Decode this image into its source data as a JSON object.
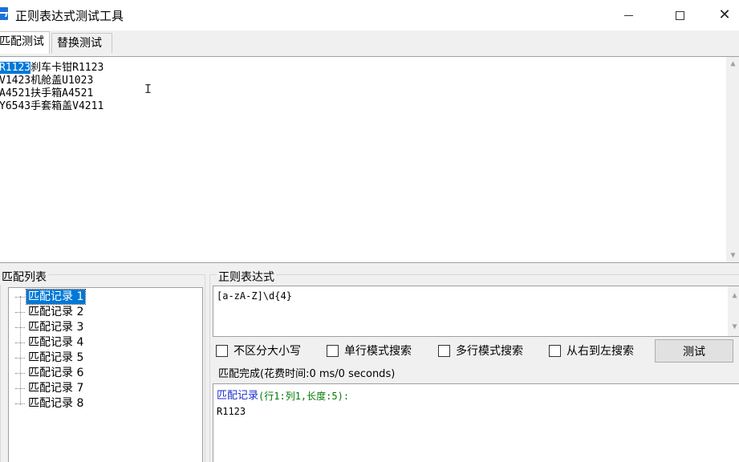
{
  "window": {
    "title": "正则表达式测试工具",
    "icon": "app-icon",
    "controls": {
      "minimize": "minimize-icon",
      "maximize": "maximize-icon",
      "close": "close-icon"
    }
  },
  "tabs": [
    {
      "label": "匹配测试",
      "active": true
    },
    {
      "label": "替换测试",
      "active": false
    }
  ],
  "input": {
    "lines": [
      {
        "selected": "R1123",
        "rest": "刹车卡钳R1123"
      },
      {
        "selected": "",
        "rest": "V1423机舱盖U1023"
      },
      {
        "selected": "",
        "rest": "A4521扶手箱A4521"
      },
      {
        "selected": "",
        "rest": "Y6543手套箱盖V4211"
      }
    ]
  },
  "match_list": {
    "label": "匹配列表",
    "items": [
      "匹配记录 1",
      "匹配记录 2",
      "匹配记录 3",
      "匹配记录 4",
      "匹配记录 5",
      "匹配记录 6",
      "匹配记录 7",
      "匹配记录 8"
    ],
    "selected_index": 0
  },
  "regex": {
    "label": "正则表达式",
    "value": "[a-zA-Z]\\d{4}"
  },
  "options": [
    {
      "label": "不区分大小写",
      "checked": false
    },
    {
      "label": "单行模式搜索",
      "checked": false
    },
    {
      "label": "多行模式搜索",
      "checked": false
    },
    {
      "label": "从右到左搜索",
      "checked": false
    }
  ],
  "test_button": "测试",
  "result": {
    "status": "匹配完成(花费时间:0 ms/0 seconds)",
    "record_label": "匹配记录",
    "record_detail": "(行1:列1,长度:5):",
    "value": "R1123"
  },
  "colors": {
    "selection": "#0078d7",
    "record_label": "#1f2ecf",
    "record_detail": "#007a00"
  }
}
